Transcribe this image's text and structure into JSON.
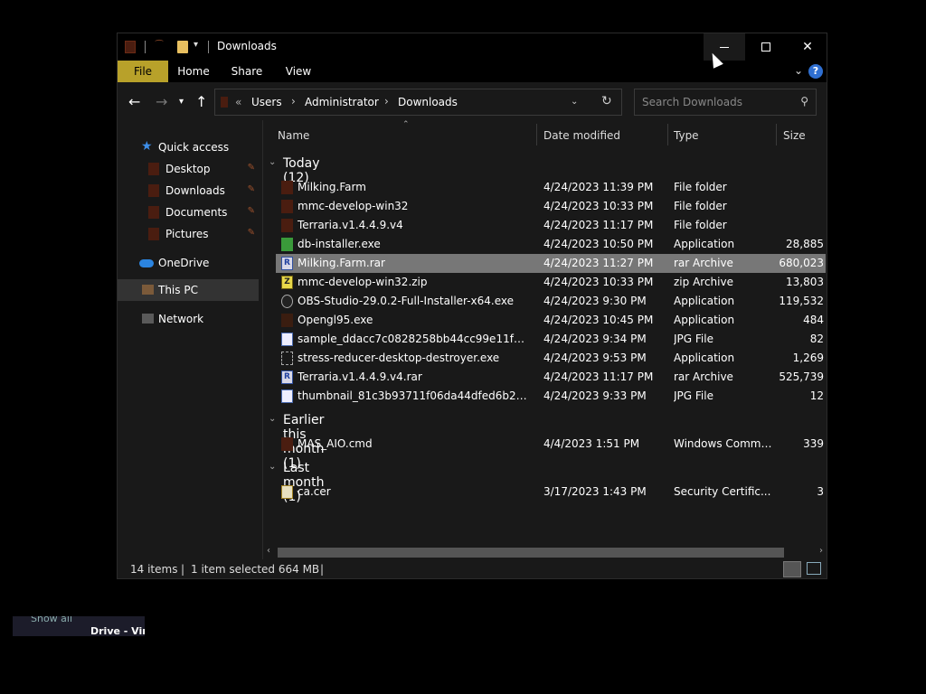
{
  "window": {
    "title": "Downloads",
    "controls": {
      "minimize": "—",
      "maximize": "□",
      "close": "✕"
    }
  },
  "ribbon": {
    "tabs": [
      "File",
      "Home",
      "Share",
      "View"
    ],
    "help": "?"
  },
  "address": {
    "overflow": "«",
    "crumbs": [
      "Users",
      "Administrator",
      "Downloads"
    ],
    "separator": "›"
  },
  "search": {
    "placeholder": "Search Downloads"
  },
  "nav": {
    "quick_access": "Quick access",
    "desktop": "Desktop",
    "downloads": "Downloads",
    "documents": "Documents",
    "pictures": "Pictures",
    "onedrive": "OneDrive",
    "this_pc": "This PC",
    "network": "Network"
  },
  "columns": {
    "name": "Name",
    "date": "Date modified",
    "type": "Type",
    "size": "Size"
  },
  "groups": {
    "today": "Today (12)",
    "earlier": "Earlier this month (1)",
    "last_month": "Last month (1)"
  },
  "files": [
    {
      "name": "Milking.Farm",
      "date": "4/24/2023 11:39 PM",
      "type": "File folder",
      "size": "",
      "icon": "folder-icon"
    },
    {
      "name": "mmc-develop-win32",
      "date": "4/24/2023 10:33 PM",
      "type": "File folder",
      "size": "",
      "icon": "folder-icon"
    },
    {
      "name": "Terraria.v1.4.4.9.v4",
      "date": "4/24/2023 11:17 PM",
      "type": "File folder",
      "size": "",
      "icon": "folder-icon"
    },
    {
      "name": "db-installer.exe",
      "date": "4/24/2023 10:50 PM",
      "type": "Application",
      "size": "28,885",
      "icon": "installer-icon"
    },
    {
      "name": "Milking.Farm.rar",
      "date": "4/24/2023 11:27 PM",
      "type": "rar Archive",
      "size": "680,023",
      "icon": "rar-archive-icon",
      "selected": true
    },
    {
      "name": "mmc-develop-win32.zip",
      "date": "4/24/2023 10:33 PM",
      "type": "zip Archive",
      "size": "13,803",
      "icon": "zip-archive-icon"
    },
    {
      "name": "OBS-Studio-29.0.2-Full-Installer-x64.exe",
      "date": "4/24/2023 9:30 PM",
      "type": "Application",
      "size": "119,532",
      "icon": "obs-icon"
    },
    {
      "name": "Opengl95.exe",
      "date": "4/24/2023 10:45 PM",
      "type": "Application",
      "size": "484",
      "icon": "app-icon"
    },
    {
      "name": "sample_ddacc7c0828258bb44cc99e11fe37a0...",
      "date": "4/24/2023 9:34 PM",
      "type": "JPG File",
      "size": "82",
      "icon": "image-file-icon"
    },
    {
      "name": "stress-reducer-desktop-destroyer.exe",
      "date": "4/24/2023 9:53 PM",
      "type": "Application",
      "size": "1,269",
      "icon": "app-icon"
    },
    {
      "name": "Terraria.v1.4.4.9.v4.rar",
      "date": "4/24/2023 11:17 PM",
      "type": "rar Archive",
      "size": "525,739",
      "icon": "rar-archive-icon"
    },
    {
      "name": "thumbnail_81c3b93711f06da44dfed6b26737d...",
      "date": "4/24/2023 9:33 PM",
      "type": "JPG File",
      "size": "12",
      "icon": "image-file-icon"
    },
    {
      "name": "MAS_AIO.cmd",
      "date": "4/4/2023 1:51 PM",
      "type": "Windows Comman...",
      "size": "339",
      "icon": "cmd-file-icon"
    },
    {
      "name": "ca.cer",
      "date": "3/17/2023 1:43 PM",
      "type": "Security Certific...",
      "size": "3",
      "icon": "certificate-icon"
    }
  ],
  "status": {
    "count": "14 items",
    "divider": "|",
    "selected": "1 item selected  664 MB"
  },
  "taskbar_fragment": {
    "show_all": "Show all",
    "drive": "Drive - Vir"
  }
}
